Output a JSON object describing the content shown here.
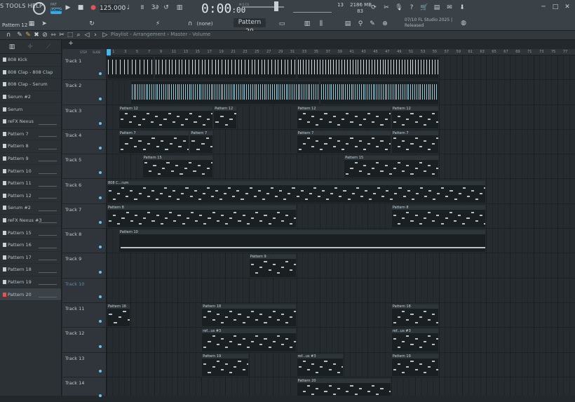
{
  "window": {
    "menu": "S TOOLS HELP",
    "pattern_selector": "Pattern 12",
    "pat_label": "PAT",
    "song_label": "SONG"
  },
  "transport": {
    "tempo": "125.000",
    "time_main": "0:00",
    "time_sub": ":00",
    "time_unit": "M:S:CS",
    "cpu_top": "13",
    "ram": "2186 MB",
    "cpu_bottom": "83"
  },
  "toolbar": {
    "none_label": "(none)",
    "pattern_box": "Pattern 20",
    "news_line1": "07/10  FL Studio 2025 |",
    "news_line2": "Released"
  },
  "playlist": {
    "breadcrumb": "Playlist - Arrangement › Master - Volume",
    "step_label": "STEP",
    "slide_label": "SLIDE"
  },
  "colors": {
    "accent": "#3ba8e0",
    "background": "#23282c",
    "clip": "#1a1f22"
  },
  "pattern_list": [
    {
      "label": "808 Kick"
    },
    {
      "label": "808 Clap - 808 Clap"
    },
    {
      "label": "808 Clap - Serum"
    },
    {
      "label": "Serum #2"
    },
    {
      "label": "Serum"
    },
    {
      "label": "reFX Nexus"
    },
    {
      "label": "Pattern 7"
    },
    {
      "label": "Pattern 8"
    },
    {
      "label": "Pattern 9"
    },
    {
      "label": "Pattern 10"
    },
    {
      "label": "Pattern 11"
    },
    {
      "label": "Pattern 12"
    },
    {
      "label": "Serum #2"
    },
    {
      "label": "reFX Nexus #3"
    },
    {
      "label": "Pattern 15"
    },
    {
      "label": "Pattern 16"
    },
    {
      "label": "Pattern 17"
    },
    {
      "label": "Pattern 18"
    },
    {
      "label": "Pattern 19"
    },
    {
      "label": "Pattern 20"
    }
  ],
  "tracks": [
    {
      "name": "Track 1"
    },
    {
      "name": "Track 2"
    },
    {
      "name": "Track 3"
    },
    {
      "name": "Track 4"
    },
    {
      "name": "Track 5"
    },
    {
      "name": "Track 6"
    },
    {
      "name": "Track 7"
    },
    {
      "name": "Track 8"
    },
    {
      "name": "Track 9"
    },
    {
      "name": "Track 10"
    },
    {
      "name": "Track 11"
    },
    {
      "name": "Track 12"
    },
    {
      "name": "Track 13"
    },
    {
      "name": "Track 14"
    }
  ],
  "ruler_ticks": [
    "1",
    "3",
    "5",
    "7",
    "9",
    "11",
    "13",
    "15",
    "17",
    "19",
    "21",
    "23",
    "25",
    "27",
    "29",
    "31",
    "33",
    "35",
    "37",
    "39",
    "41",
    "43",
    "45",
    "47",
    "49",
    "51",
    "53",
    "55",
    "57",
    "59",
    "61",
    "63",
    "65",
    "67",
    "69",
    "71",
    "73",
    "75",
    "77",
    "79"
  ],
  "clips": [
    {
      "track": 2,
      "start": 3,
      "len": 16,
      "label": "Pattern 12"
    },
    {
      "track": 2,
      "start": 19,
      "len": 4,
      "label": "Pattern 12"
    },
    {
      "track": 2,
      "start": 33,
      "len": 16,
      "label": "Pattern 12"
    },
    {
      "track": 2,
      "start": 49,
      "len": 8,
      "label": "Pattern 12"
    },
    {
      "track": 3,
      "start": 3,
      "len": 12,
      "label": "Pattern 7"
    },
    {
      "track": 3,
      "start": 15,
      "len": 4,
      "label": "Pattern 7"
    },
    {
      "track": 3,
      "start": 33,
      "len": 16,
      "label": "Pattern 7"
    },
    {
      "track": 3,
      "start": 49,
      "len": 8,
      "label": "Pattern 7"
    },
    {
      "track": 4,
      "start": 7,
      "len": 12,
      "label": "Pattern 15"
    },
    {
      "track": 4,
      "start": 41,
      "len": 16,
      "label": "Pattern 15"
    },
    {
      "track": 5,
      "start": 1,
      "len": 64,
      "label": "808 C...rum"
    },
    {
      "track": 6,
      "start": 1,
      "len": 32,
      "label": "Pattern 8"
    },
    {
      "track": 6,
      "start": 49,
      "len": 16,
      "label": "Pattern 8"
    },
    {
      "track": 7,
      "start": 3,
      "len": 62,
      "label": "Pattern 10"
    },
    {
      "track": 8,
      "start": 25,
      "len": 8,
      "label": "Pattern 9"
    },
    {
      "track": 10,
      "start": 1,
      "len": 4,
      "label": "Pattern 16"
    },
    {
      "track": 10,
      "start": 17,
      "len": 16,
      "label": "Pattern 18"
    },
    {
      "track": 10,
      "start": 49,
      "len": 8,
      "label": "Pattern 18"
    },
    {
      "track": 11,
      "start": 17,
      "len": 16,
      "label": "ref...us #3"
    },
    {
      "track": 11,
      "start": 49,
      "len": 8,
      "label": "ref...us #3"
    },
    {
      "track": 12,
      "start": 17,
      "len": 8,
      "label": "Pattern 19"
    },
    {
      "track": 12,
      "start": 33,
      "len": 8,
      "label": "ref...us #3"
    },
    {
      "track": 12,
      "start": 49,
      "len": 8,
      "label": "Pattern 19"
    },
    {
      "track": 13,
      "start": 33,
      "len": 16,
      "label": "Pattern 20"
    }
  ]
}
